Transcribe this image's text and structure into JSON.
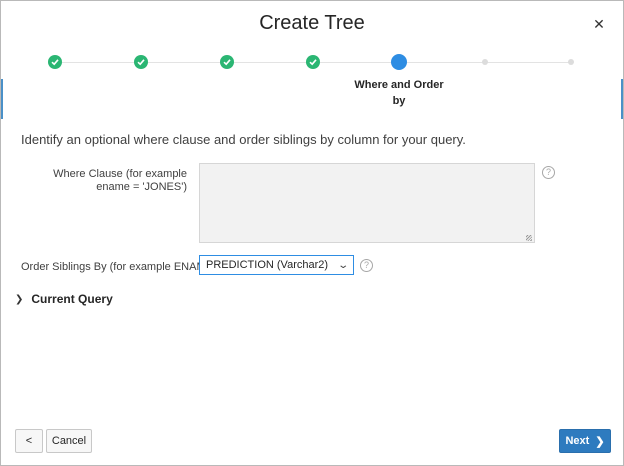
{
  "dialog": {
    "title": "Create Tree",
    "close_icon": "close-icon"
  },
  "wizard": {
    "steps": [
      {
        "state": "done",
        "label": ""
      },
      {
        "state": "done",
        "label": ""
      },
      {
        "state": "done",
        "label": ""
      },
      {
        "state": "done",
        "label": ""
      },
      {
        "state": "current",
        "label": "Where and Order by"
      },
      {
        "state": "future",
        "label": ""
      },
      {
        "state": "future",
        "label": ""
      }
    ]
  },
  "intro_text": "Identify an optional where clause and order siblings by column for your query.",
  "where_clause": {
    "label": "Where Clause (for example ename = 'JONES')",
    "value": ""
  },
  "order_siblings": {
    "label": "Order Siblings By (for example ENAME)",
    "selected": "PREDICTION (Varchar2)"
  },
  "current_query": {
    "label": "Current Query"
  },
  "footer": {
    "back_label": "<",
    "cancel_label": "Cancel",
    "next_label": "Next"
  },
  "colors": {
    "accent": "#2e8de3",
    "done": "#2bb673",
    "primary_button": "#2e7bbf"
  }
}
